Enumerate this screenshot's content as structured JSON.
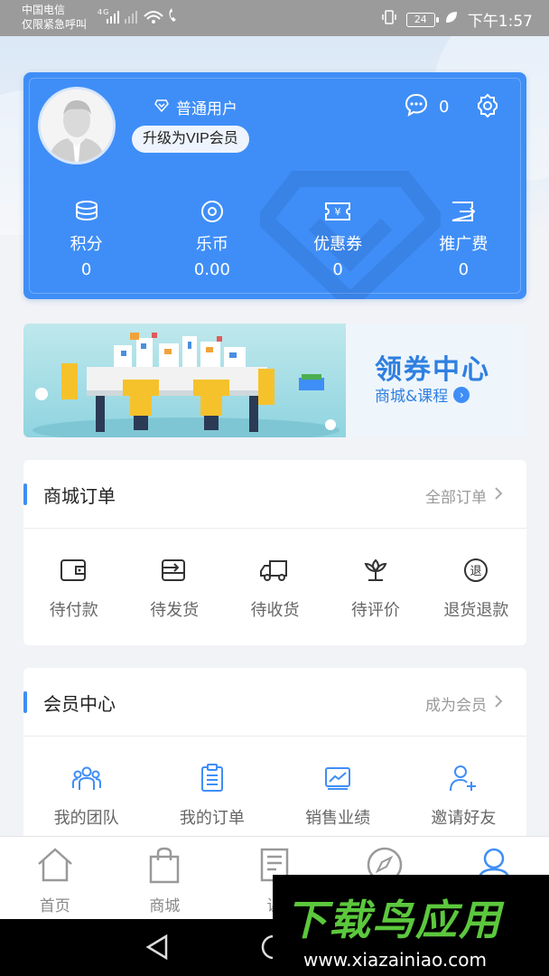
{
  "statusbar": {
    "carrier": "中国电信",
    "carrier_note": "仅限紧急呼叫",
    "signal_text": "⁴ᴳ",
    "battery": "24",
    "time": "下午1:57"
  },
  "profile": {
    "user_level": "普通用户",
    "upgrade_label": "升级为VIP会员",
    "message_count": "0",
    "stats": [
      {
        "label": "积分",
        "value": "0",
        "icon": "coins-icon"
      },
      {
        "label": "乐币",
        "value": "0.00",
        "icon": "coin-circle-icon"
      },
      {
        "label": "优惠券",
        "value": "0",
        "icon": "coupon-icon"
      },
      {
        "label": "推广费",
        "value": "0",
        "icon": "promo-fee-icon"
      }
    ]
  },
  "banner": {
    "title": "领券中心",
    "subtitle": "商城&课程"
  },
  "orders": {
    "title": "商城订单",
    "more": "全部订单",
    "items": [
      {
        "label": "待付款",
        "icon": "wallet-icon"
      },
      {
        "label": "待发货",
        "icon": "ship-icon"
      },
      {
        "label": "待收货",
        "icon": "truck-icon"
      },
      {
        "label": "待评价",
        "icon": "flower-icon"
      },
      {
        "label": "退货退款",
        "icon": "refund-icon",
        "glyph": "退"
      }
    ]
  },
  "member": {
    "title": "会员中心",
    "more": "成为会员",
    "items": [
      {
        "label": "我的团队",
        "icon": "team-icon"
      },
      {
        "label": "我的订单",
        "icon": "clipboard-icon"
      },
      {
        "label": "销售业绩",
        "icon": "chart-icon"
      },
      {
        "label": "邀请好友",
        "icon": "add-user-icon"
      }
    ]
  },
  "tabs": [
    {
      "label": "首页",
      "icon": "home-icon"
    },
    {
      "label": "商城",
      "icon": "bag-icon"
    },
    {
      "label": "课",
      "icon": "book-icon"
    },
    {
      "label": "",
      "icon": "compass-icon"
    },
    {
      "label": "",
      "icon": "user-icon"
    }
  ],
  "promo": {
    "title": "下载鸟应用",
    "url": "www.xiazainiao.com"
  },
  "colors": {
    "accent": "#3f8ef7",
    "promo_green": "#5cc83d"
  }
}
